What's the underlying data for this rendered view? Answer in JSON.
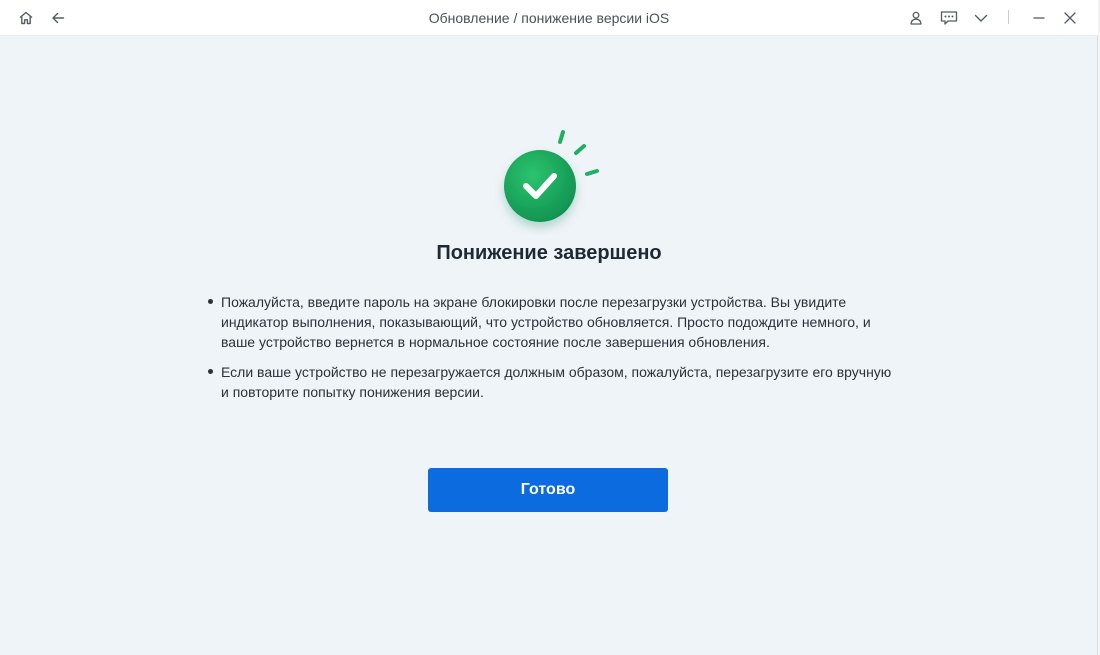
{
  "window": {
    "title": "Обновление / понижение версии iOS",
    "icons": {
      "home": "home-icon",
      "back": "arrow-left-icon",
      "account": "user-icon",
      "feedback": "chat-icon",
      "menu": "chevron-down-icon",
      "minimize": "minimize-icon",
      "close": "close-icon"
    }
  },
  "main": {
    "status_icon": "check-circle-icon",
    "heading": "Понижение завершено",
    "bullets": [
      "Пожалуйста, введите пароль на экране блокировки после перезагрузки устройства. Вы увидите индикатор выполнения, показывающий, что устройство обновляется. Просто подождите немного, и ваше устройство вернется в нормальное состояние после завершения обновления.",
      "Если ваше устройство не перезагружается должным образом, пожалуйста, перезагрузите его вручную и повторите попытку понижения версии."
    ],
    "done_button": "Готово"
  },
  "colors": {
    "accent": "#0d6be0",
    "success": "#16a35a",
    "background": "#eff4f9"
  }
}
